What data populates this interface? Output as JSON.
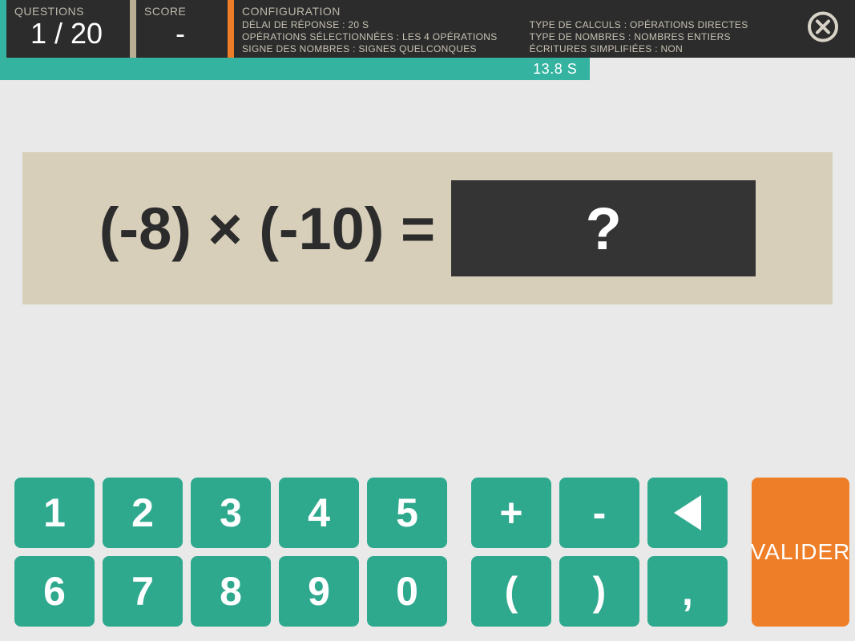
{
  "header": {
    "questions_label": "QUESTIONS",
    "questions_value": "1 / 20",
    "score_label": "SCORE",
    "score_value": "-",
    "config_label": "CONFIGURATION",
    "config": {
      "col1": [
        {
          "label": "DÉLAI DE RÉPONSE",
          "value": "20 S"
        },
        {
          "label": "OPÉRATIONS SÉLECTIONNÉES",
          "value": "LES 4 OPÉRATIONS"
        },
        {
          "label": "SIGNE DES NOMBRES",
          "value": "SIGNES QUELCONQUES"
        }
      ],
      "col2": [
        {
          "label": "TYPE DE CALCULS",
          "value": "OPÉRATIONS DIRECTES"
        },
        {
          "label": "TYPE DE NOMBRES",
          "value": "NOMBRES ENTIERS"
        },
        {
          "label": "ÉCRITURES SIMPLIFIÉES",
          "value": "NON"
        }
      ]
    }
  },
  "timer": {
    "text": "13.8 S",
    "percent": 69
  },
  "question": {
    "expression": "(-8) × (-10) =",
    "answer_placeholder": "?"
  },
  "keypad": {
    "digits": [
      "1",
      "2",
      "3",
      "4",
      "5",
      "6",
      "7",
      "8",
      "9",
      "0"
    ],
    "symbols": [
      "+",
      "-",
      "backspace",
      "(",
      ")",
      ","
    ]
  },
  "validate_label": "VALIDER",
  "colors": {
    "teal": "#34b3a0",
    "keypad_teal": "#2fa98e",
    "orange": "#ef7e28",
    "tan": "#b9ae92",
    "dark": "#2c2c2c",
    "panel": "#d8cfba"
  }
}
